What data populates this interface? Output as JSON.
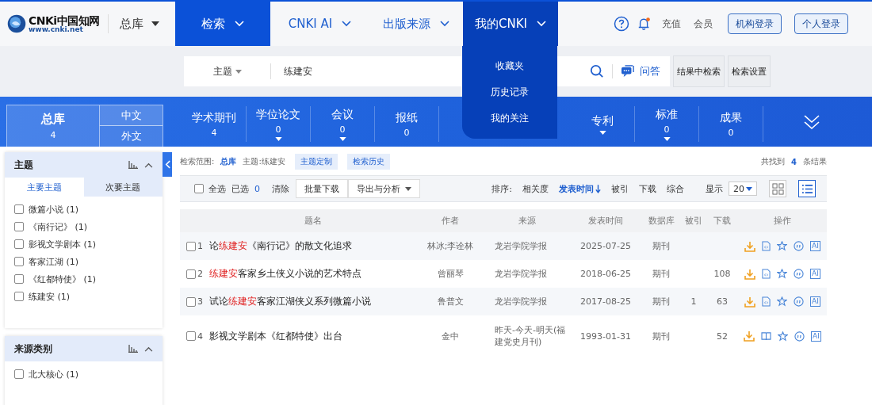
{
  "logo": {
    "mark": "CNKi中国知网",
    "url": "www.cnki.net"
  },
  "db_selector": {
    "label": "总库"
  },
  "nav": [
    {
      "label": "检索",
      "selected": true,
      "expanded": false
    },
    {
      "label": "CNKI AI",
      "selected": false,
      "expanded": false
    },
    {
      "label": "出版来源",
      "selected": false,
      "expanded": false
    },
    {
      "label": "我的CNKI",
      "selected": false,
      "expanded": true
    }
  ],
  "nav_menu": [
    "收藏夹",
    "历史记录",
    "我的关注"
  ],
  "header_links": [
    "充值",
    "会员"
  ],
  "header_buttons": [
    "机构登录",
    "个人登录"
  ],
  "search": {
    "field": "主题",
    "value": "练建安",
    "qa_label": "问答"
  },
  "search_buttons": [
    "结果中检索",
    "检索设置"
  ],
  "db_all": {
    "label": "总库",
    "count": "4",
    "languages": [
      {
        "label": "中文",
        "selected": true
      },
      {
        "label": "外文",
        "selected": false
      }
    ]
  },
  "db_tabs": [
    {
      "label": "学术期刊",
      "count": "4",
      "has_menu": false
    },
    {
      "label": "学位论文",
      "count": "0",
      "has_menu": true
    },
    {
      "label": "会议",
      "count": "0",
      "has_menu": true
    },
    {
      "label": "报纸",
      "count": "0",
      "has_menu": false
    },
    {
      "label": "专利",
      "has_menu": true
    },
    {
      "label": "标准",
      "count": "0",
      "has_menu": true
    },
    {
      "label": "成果",
      "count": "0",
      "has_menu": false
    }
  ],
  "filters": [
    {
      "title": "主题",
      "tabs": [
        {
          "label": "主要主题",
          "selected": true
        },
        {
          "label": "次要主题",
          "selected": false
        }
      ],
      "items": [
        {
          "label": "微篇小说 (1)",
          "checked": false
        },
        {
          "label": "《南行记》 (1)",
          "checked": false
        },
        {
          "label": "影视文学剧本 (1)",
          "checked": false
        },
        {
          "label": "客家江湖 (1)",
          "checked": false
        },
        {
          "label": "《红都特使》 (1)",
          "checked": false
        },
        {
          "label": "练建安 (1)",
          "checked": false
        }
      ]
    },
    {
      "title": "来源类别",
      "items": [
        {
          "label": "北大核心 (1)",
          "checked": false
        }
      ]
    }
  ],
  "scope": {
    "label": "检索范围:",
    "db": "总库",
    "query": "主题:练建安",
    "tags": [
      "主题定制",
      "检索历史"
    ]
  },
  "result_count": {
    "prefix": "共找到",
    "count": "4",
    "suffix": "条结果"
  },
  "toolbar": {
    "select_all": {
      "label": "全选",
      "checked": false
    },
    "selected_label": "已选",
    "selected_count": "0",
    "clear": "清除",
    "batch": "批量下载",
    "export": "导出与分析",
    "sort_label": "排序:",
    "sort": [
      {
        "label": "相关度",
        "selected": false
      },
      {
        "label": "发表时间",
        "selected": true
      },
      {
        "label": "被引",
        "selected": false
      },
      {
        "label": "下载",
        "selected": false
      },
      {
        "label": "综合",
        "selected": false
      }
    ],
    "show_label": "显示",
    "page_size": "20",
    "views": [
      {
        "kind": "grid",
        "selected": false
      },
      {
        "kind": "list",
        "selected": true
      }
    ]
  },
  "table": {
    "columns": [
      "题名",
      "作者",
      "来源",
      "发表时间",
      "数据库",
      "被引",
      "下载",
      "操作"
    ],
    "rows": [
      {
        "num": "1",
        "checked": false,
        "title": [
          {
            "text": "论",
            "highlight": false
          },
          {
            "text": "练建安",
            "highlight": true
          },
          {
            "text": "《南行记》的散文化追求",
            "highlight": false
          }
        ],
        "author": "林冰;李诠林",
        "source": "龙岩学院学报",
        "date": "2025-07-25",
        "db": "期刊",
        "cited": "",
        "downloads": "",
        "kind": "html",
        "ai_label": "AI"
      },
      {
        "num": "2",
        "checked": false,
        "title": [
          {
            "text": "练建安",
            "highlight": true
          },
          {
            "text": "客家乡土侠义小说的艺术特点",
            "highlight": false
          }
        ],
        "author": "曾丽琴",
        "source": "龙岩学院学报",
        "date": "2018-06-25",
        "db": "期刊",
        "cited": "",
        "downloads": "108",
        "kind": "html",
        "ai_label": "AI"
      },
      {
        "num": "3",
        "checked": false,
        "title": [
          {
            "text": "试论",
            "highlight": false
          },
          {
            "text": "练建安",
            "highlight": true
          },
          {
            "text": "客家江湖侠义系列微篇小说",
            "highlight": false
          }
        ],
        "author": "鲁普文",
        "source": "龙岩学院学报",
        "date": "2017-08-25",
        "db": "期刊",
        "cited": "1",
        "downloads": "63",
        "kind": "html",
        "ai_label": "AI"
      },
      {
        "num": "4",
        "checked": false,
        "title": [
          {
            "text": "影视文学剧本《红都特使》出台",
            "highlight": false
          }
        ],
        "author": "金中",
        "source": "昨天-今天-明天(福建党史月刊)",
        "date": "1993-01-31",
        "db": "期刊",
        "cited": "",
        "downloads": "52",
        "kind": "book",
        "ai_label": "AI"
      }
    ]
  }
}
